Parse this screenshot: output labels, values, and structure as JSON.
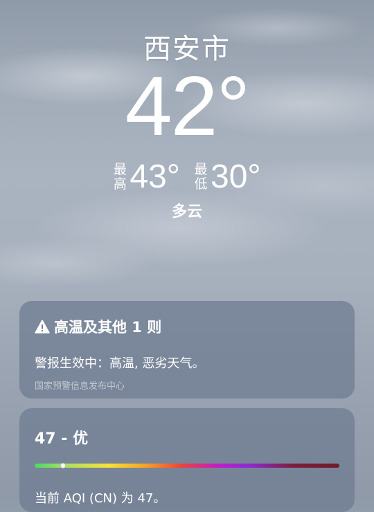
{
  "location": {
    "city": "西安市",
    "temperature": "42°",
    "high_label": "最高",
    "high_value": "43°",
    "low_label": "最低",
    "low_value": "30°",
    "condition": "多云"
  },
  "alert": {
    "icon": "warning-triangle-icon",
    "title": "高温及其他 1 则",
    "body": "警报生效中：高温, 恶劣天气。",
    "source": "国家预警信息发布中心"
  },
  "aqi": {
    "headline": "47 - 优",
    "value": 47,
    "scale_max": 500,
    "description": "当前 AQI (CN) 为 47。"
  }
}
